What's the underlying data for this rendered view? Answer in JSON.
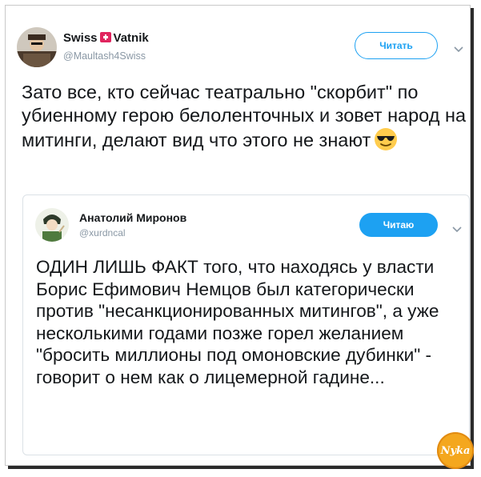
{
  "tweet": {
    "author_name_part1": "Swiss",
    "author_name_part2": "Vatnik",
    "author_handle": "@Maultash4Swiss",
    "follow_label": "Читать",
    "text": "Зато все, кто сейчас театрально \"скорбит\" по убиенному герою белоленточных и зовет народ на митинги, делают вид что этого не знают",
    "emoji": "sunglasses-face"
  },
  "quoted_tweet": {
    "author_name": "Анатолий Миронов",
    "author_handle": "@xurdncal",
    "follow_label": "Читаю",
    "text": "ОДИН ЛИШЬ ФАКТ того, что находясь у власти Борис Ефимович Немцов был категорически против \"несанкционированных митингов\", а уже несколькими годами позже горел желанием \"бросить миллионы под омоновские дубинки\" - говорит о нем как о лицемерной гадине..."
  },
  "watermark": {
    "text": "Nyka",
    "color": "#f4a71e"
  },
  "colors": {
    "accent": "#1da1f2",
    "text": "#14171a",
    "muted": "#8a98a5",
    "flag_red": "#e0245e"
  }
}
